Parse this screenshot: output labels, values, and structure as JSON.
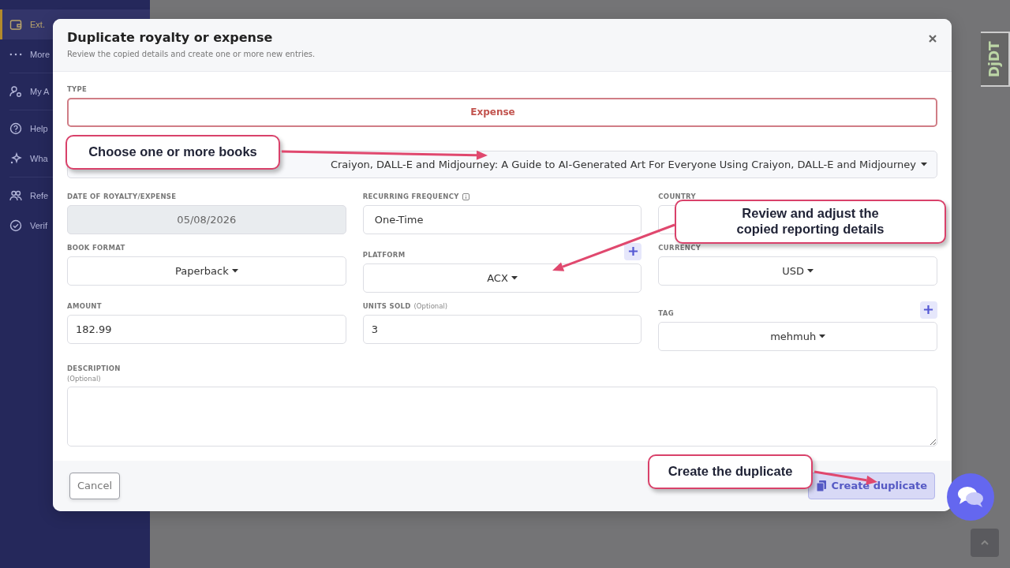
{
  "sidebar": {
    "items": [
      {
        "label": "Ext.",
        "selected": true
      },
      {
        "label": "More",
        "selected": false
      },
      {
        "label": "My A",
        "selected": false
      },
      {
        "label": "Help",
        "selected": false
      },
      {
        "label": "Wha",
        "selected": false
      },
      {
        "label": "Refe",
        "selected": false
      },
      {
        "label": "Verif",
        "selected": false
      }
    ]
  },
  "modal": {
    "title": "Duplicate royalty or expense",
    "subtitle": "Review the copied details and create one or more new entries.",
    "type": {
      "label": "TYPE",
      "value": "Expense",
      "invalid": true
    },
    "books": {
      "value": "Craiyon, DALL-E and Midjourney: A Guide to AI-Generated Art For Everyone Using Craiyon, DALL-E and Midjourney"
    },
    "fields": [
      {
        "kind": "date",
        "label": "DATE OF ROYALTY/EXPENSE",
        "value": "05/08/2026",
        "disabled": true
      },
      {
        "kind": "select",
        "label": "RECURRING FREQUENCY",
        "value": "One-Time",
        "info": true
      },
      {
        "kind": "select",
        "label": "COUNTRY"
      },
      {
        "kind": "dropdown",
        "label": "BOOK FORMAT",
        "value": "Paperback"
      },
      {
        "kind": "dropdown",
        "label": "PLATFORM",
        "value": "ACX",
        "add": true
      },
      {
        "kind": "dropdown",
        "label": "CURRENCY",
        "value": "USD"
      },
      {
        "kind": "number",
        "label": "AMOUNT",
        "value": "182.99"
      },
      {
        "kind": "number",
        "label": "UNITS SOLD",
        "hint": "(Optional)",
        "value": "3"
      },
      {
        "kind": "dropdown",
        "label": "TAG",
        "value": "mehmuh",
        "add": true
      }
    ],
    "description": {
      "label": "DESCRIPTION",
      "hint": "(Optional)"
    },
    "buttons": [
      {
        "label": "Cancel",
        "kind": "cancel"
      },
      {
        "label": "Create duplicate",
        "kind": "primary"
      }
    ]
  },
  "annotations": [
    {
      "text": "Choose one or more books"
    },
    {
      "text": "Review and adjust the\ncopied reporting details"
    },
    {
      "text": "Create the duplicate"
    }
  ],
  "debug_toolbar": {
    "label": "DjDT"
  }
}
